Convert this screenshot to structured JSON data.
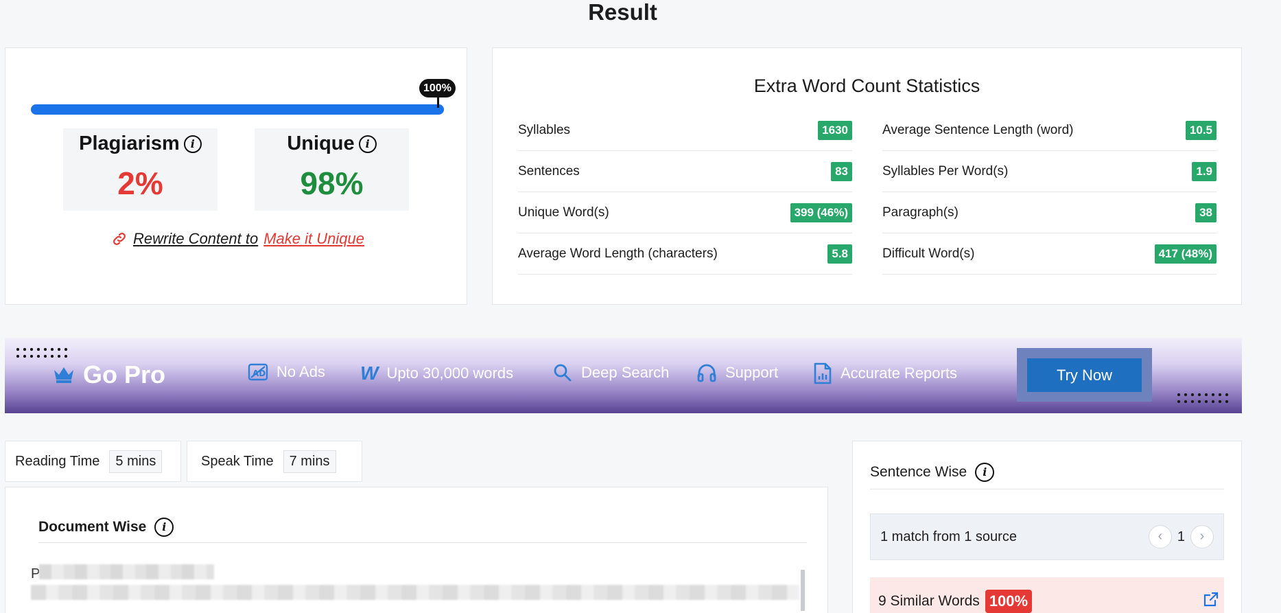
{
  "title": "Result",
  "score": {
    "progress_label": "100%",
    "progress_value": 100,
    "plagiarism_label": "Plagiarism",
    "plagiarism_value": "2%",
    "unique_label": "Unique",
    "unique_value": "98%",
    "rewrite_text": "Rewrite Content to",
    "rewrite_link": "Make it Unique"
  },
  "stats": {
    "title": "Extra Word Count Statistics",
    "left": [
      {
        "label": "Syllables",
        "value": "1630"
      },
      {
        "label": "Sentences",
        "value": "83"
      },
      {
        "label": "Unique Word(s)",
        "value": "399 (46%)"
      },
      {
        "label": "Average Word Length (characters)",
        "value": "5.8"
      }
    ],
    "right": [
      {
        "label": "Average Sentence Length (word)",
        "value": "10.5"
      },
      {
        "label": "Syllables Per Word(s)",
        "value": "1.9"
      },
      {
        "label": "Paragraph(s)",
        "value": "38"
      },
      {
        "label": "Difficult Word(s)",
        "value": "417 (48%)"
      }
    ]
  },
  "gopro": {
    "title": "Go Pro",
    "features": [
      "No Ads",
      "Upto 30,000 words",
      "Deep Search",
      "Support",
      "Accurate Reports"
    ],
    "cta": "Try Now",
    "colors": {
      "cta": "#1e6fbf",
      "banner_dark": "#574393"
    }
  },
  "times": {
    "reading_label": "Reading Time",
    "reading_value": "5 mins",
    "speak_label": "Speak Time",
    "speak_value": "7 mins"
  },
  "document": {
    "title": "Document Wise",
    "first_char": "P"
  },
  "sentence": {
    "title": "Sentence Wise",
    "match_text": "1 match from 1 source",
    "page": "1",
    "similar_text": "9 Similar Words",
    "similar_pct": "100%"
  },
  "colors": {
    "accent": "#1a73e8",
    "danger": "#e53935",
    "success": "#1e8e3e",
    "badge": "#28a86a"
  }
}
